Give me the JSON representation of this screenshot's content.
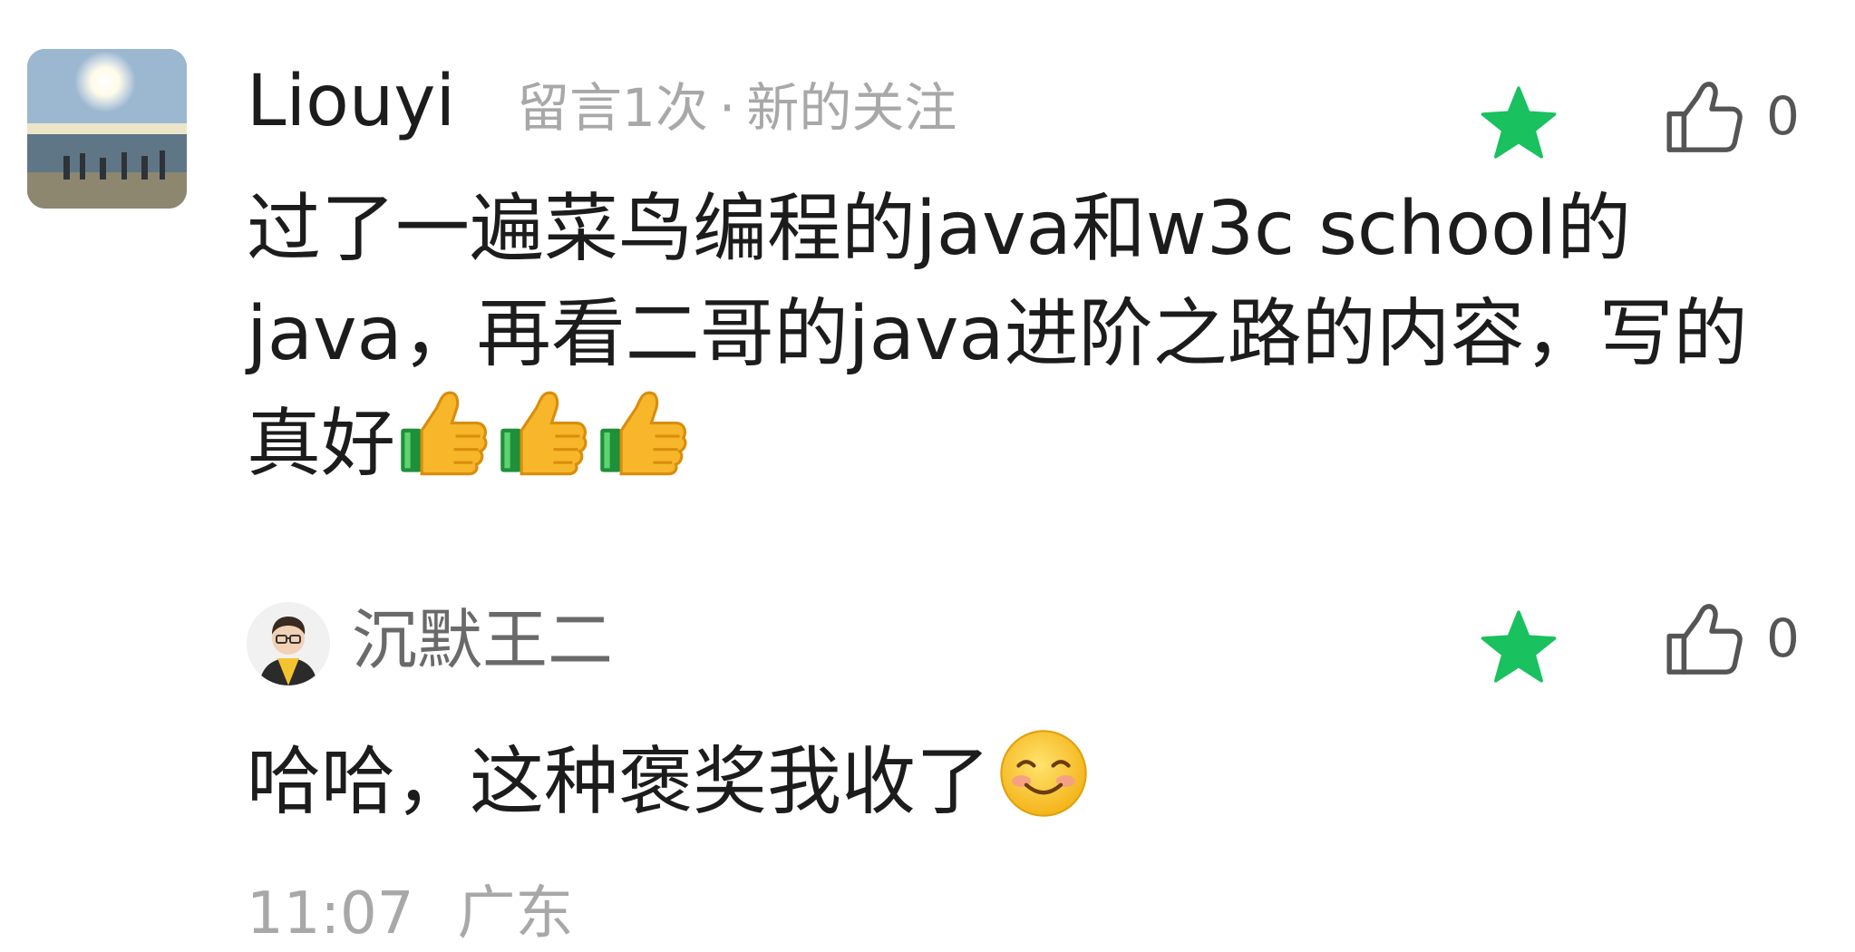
{
  "comment": {
    "author": "Liouyi",
    "comment_count_text": "留言1次",
    "separator": "·",
    "follow_text": "新的关注",
    "text": "过了一遍菜鸟编程的java和w3c school的java，再看二哥的java进阶之路的内容，写的真好",
    "emoji": [
      "thumbs-up",
      "thumbs-up",
      "thumbs-up"
    ],
    "like_count": "0",
    "accent_color": "#19c15f"
  },
  "reply": {
    "author": "沉默王二",
    "text": "哈哈，这种褒奖我收了",
    "emoji": "smiling-face",
    "like_count": "0",
    "time": "11:07",
    "location": "广东"
  }
}
